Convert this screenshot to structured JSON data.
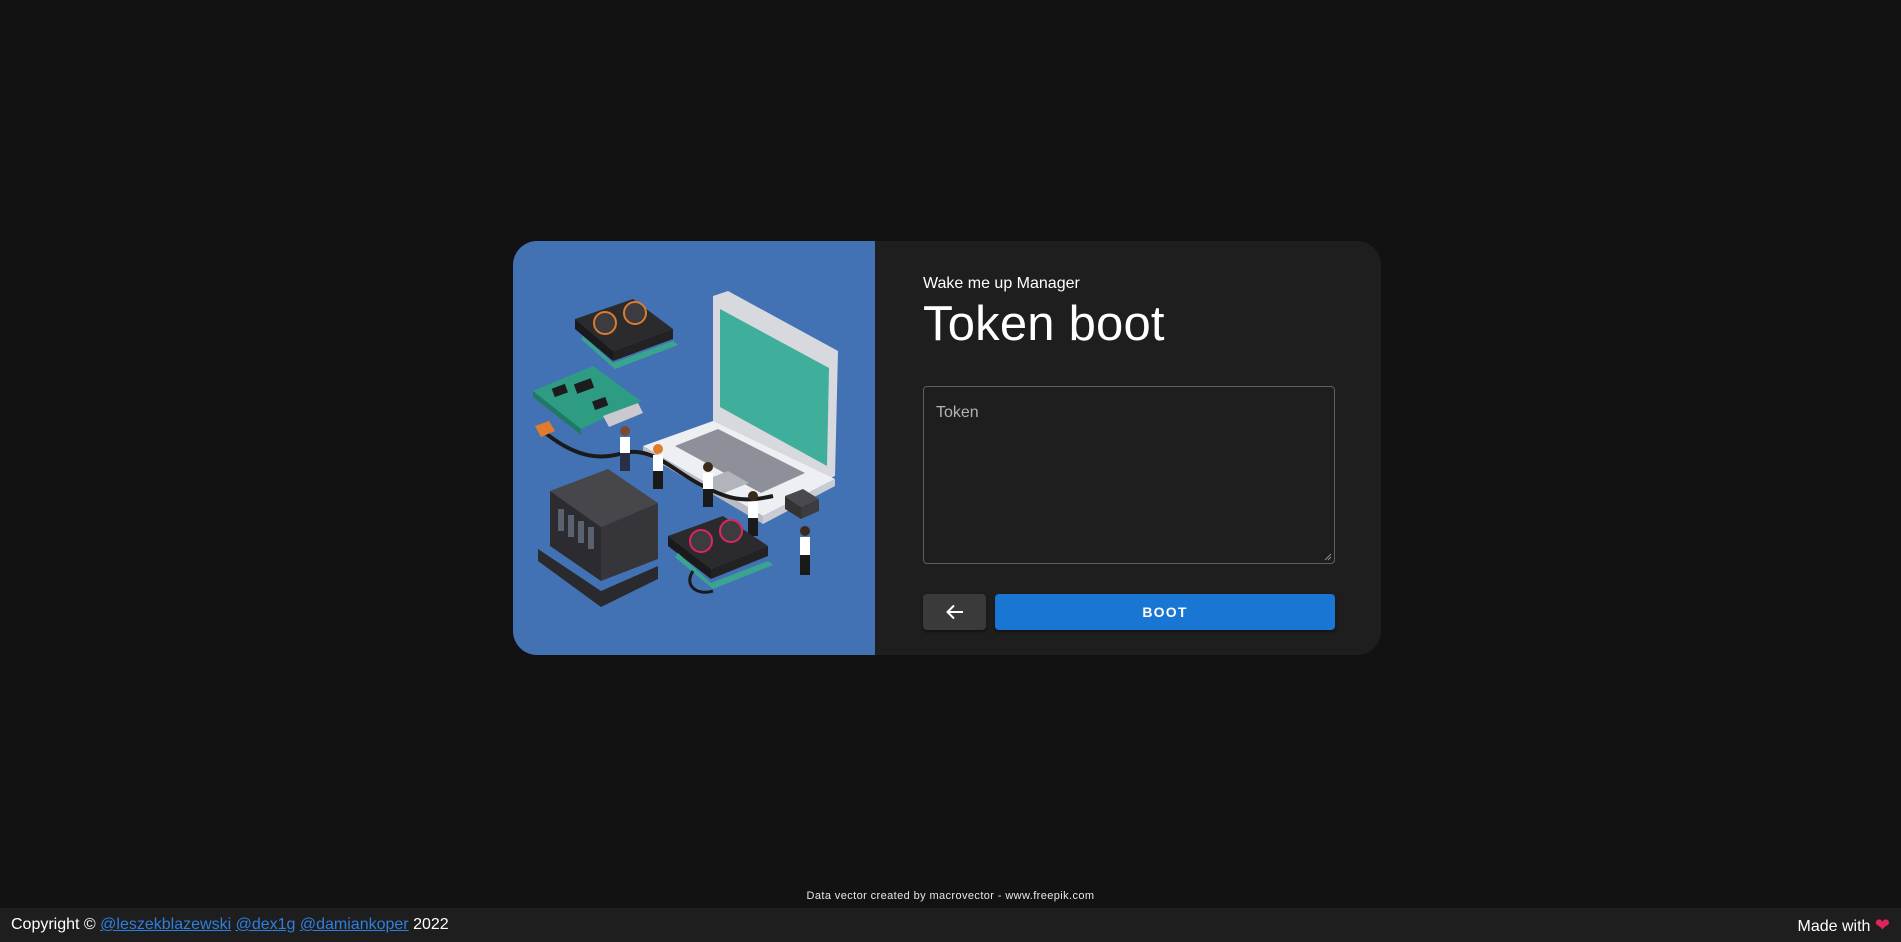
{
  "header": {
    "app_name": "Wake me up Manager",
    "page_title": "Token boot"
  },
  "form": {
    "token_placeholder": "Token",
    "token_value": "",
    "back_icon": "arrow-left-icon",
    "boot_label": "BOOT"
  },
  "credit": {
    "text": "Data vector created by macrovector - www.freepik.com"
  },
  "footer": {
    "copyright_prefix": "Copyright ©",
    "authors": [
      "@leszekblazewski",
      "@dex1g",
      "@damiankoper"
    ],
    "year": "2022",
    "made_with": "Made with",
    "heart_icon": "heart-icon",
    "heart_glyph": "❤"
  },
  "colors": {
    "background": "#121212",
    "card": "#1e1e1e",
    "illustration_bg": "#4372b4",
    "primary": "#1976d2",
    "link": "#2f7fe0"
  }
}
